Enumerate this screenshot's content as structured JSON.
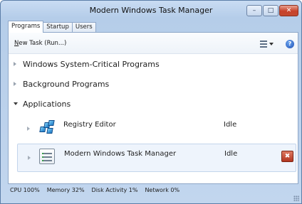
{
  "window": {
    "title": "Modern Windows Task Manager",
    "controls": {
      "minimize": "–",
      "maximize": "□",
      "close": "✕"
    }
  },
  "tabs": [
    {
      "label": "Programs",
      "active": true
    },
    {
      "label": "Startup",
      "active": false
    },
    {
      "label": "Users",
      "active": false
    }
  ],
  "toolbar": {
    "new_task_prefix": "N",
    "new_task_rest": "ew Task (Run...)",
    "view_icon": "view-options-icon",
    "help_label": "?"
  },
  "groups": [
    {
      "label": "Windows System-Critical Programs",
      "expanded": false
    },
    {
      "label": "Background Programs",
      "expanded": false
    },
    {
      "label": "Applications",
      "expanded": true
    }
  ],
  "applications": [
    {
      "name": "Registry Editor",
      "status": "Idle",
      "icon": "registry-editor-icon",
      "selected": false
    },
    {
      "name": "Modern Windows Task Manager",
      "status": "Idle",
      "icon": "task-manager-icon",
      "selected": true,
      "end_task_label": "✖"
    }
  ],
  "status_bar": {
    "cpu": "CPU 100%",
    "memory": "Memory 32%",
    "disk": "Disk Activity 1%",
    "network": "Network 0%"
  },
  "colors": {
    "frame": "#b5cde9",
    "close_button": "#c7412a",
    "selection": "#eef4fc"
  }
}
